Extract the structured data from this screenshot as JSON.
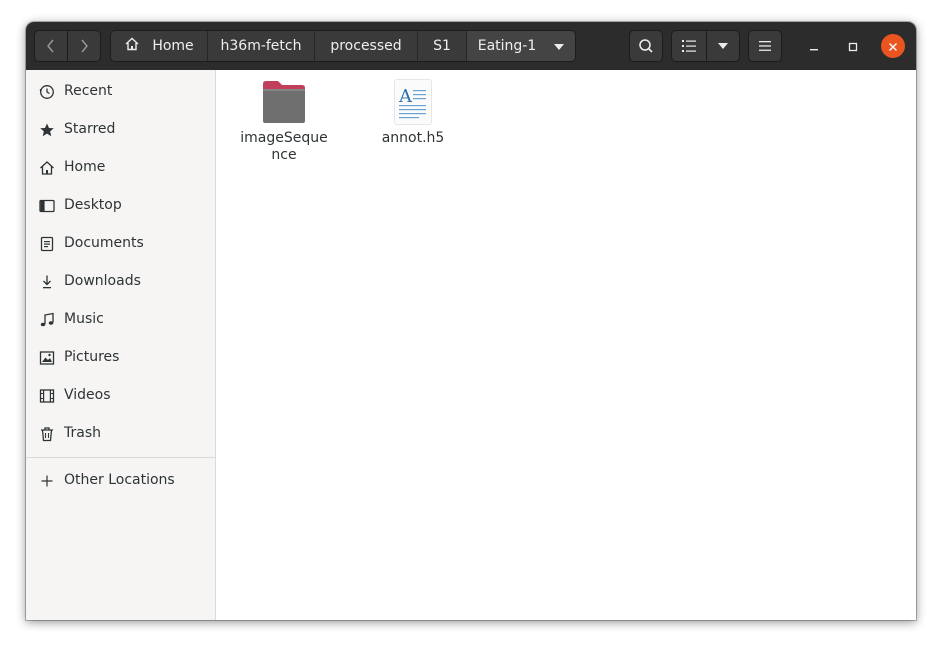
{
  "nav": {
    "back_icon": "chevron-left-icon",
    "forward_icon": "chevron-right-icon"
  },
  "breadcrumbs": [
    {
      "label": "Home",
      "icon": "home-icon"
    },
    {
      "label": "h36m-fetch"
    },
    {
      "label": "processed"
    },
    {
      "label": "S1"
    },
    {
      "label": "Eating-1",
      "icon": "dropdown-arrow-icon"
    }
  ],
  "toolbar": {
    "search_icon": "search-icon",
    "view_icon": "list-view-icon",
    "view_options_icon": "dropdown-arrow-icon",
    "menu_icon": "hamburger-menu-icon"
  },
  "window_controls": {
    "minimize_icon": "minimize-icon",
    "maximize_icon": "maximize-icon",
    "close_icon": "close-icon",
    "close_color": "#e95420"
  },
  "sidebar": {
    "items": [
      {
        "label": "Recent",
        "icon": "clock-icon"
      },
      {
        "label": "Starred",
        "icon": "star-icon"
      },
      {
        "label": "Home",
        "icon": "home-icon"
      },
      {
        "label": "Desktop",
        "icon": "desktop-icon"
      },
      {
        "label": "Documents",
        "icon": "document-icon"
      },
      {
        "label": "Downloads",
        "icon": "download-icon"
      },
      {
        "label": "Music",
        "icon": "music-icon"
      },
      {
        "label": "Pictures",
        "icon": "picture-icon"
      },
      {
        "label": "Videos",
        "icon": "video-icon"
      },
      {
        "label": "Trash",
        "icon": "trash-icon"
      }
    ],
    "other": {
      "label": "Other Locations",
      "icon": "plus-icon"
    }
  },
  "files": [
    {
      "name": "imageSequence",
      "type": "folder",
      "icon": "folder-icon"
    },
    {
      "name": "annot.h5",
      "type": "text-document",
      "icon": "text-document-icon"
    }
  ],
  "colors": {
    "headerbar": "#2c2c2c",
    "sidebar": "#f6f5f4",
    "folder": "#6f6f6f",
    "folder_tab": "#c23f5b"
  }
}
